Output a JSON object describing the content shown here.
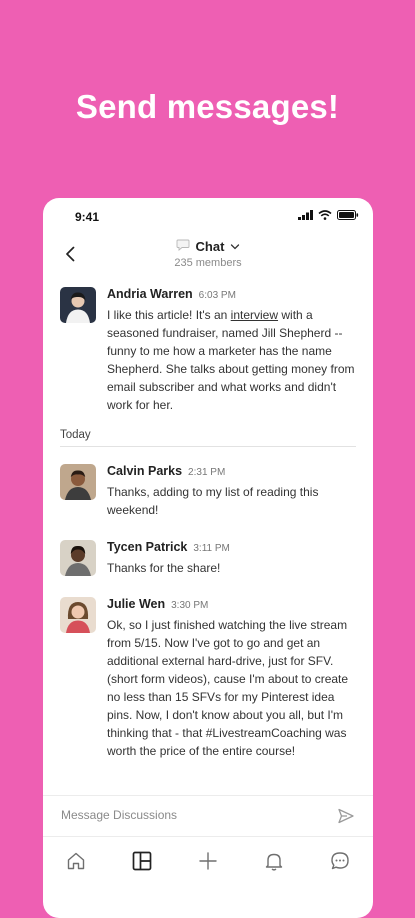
{
  "headline": "Send messages!",
  "status": {
    "time": "9:41"
  },
  "header": {
    "title": "Chat",
    "members": "235 members"
  },
  "messages_top": [
    {
      "name": "Andria Warren",
      "time": "6:03 PM",
      "text_pre": "I like this article! It's an ",
      "link": "interview",
      "text_post": " with a seasoned fundraiser, named Jill Shepherd --funny to me how a marketer has the name Shepherd. She talks about getting money from email subscriber and what works and didn't work for her."
    }
  ],
  "day_label": "Today",
  "messages": [
    {
      "name": "Calvin Parks",
      "time": "2:31 PM",
      "text": "Thanks, adding to my list of reading this weekend!"
    },
    {
      "name": "Tycen Patrick",
      "time": "3:11 PM",
      "text": "Thanks for the share!"
    },
    {
      "name": "Julie Wen",
      "time": "3:30 PM",
      "text": "Ok, so I just finished watching the live stream from 5/15. Now I've got to go and get an additional external hard-drive, just for SFV. (short form videos), cause I'm about to create no less than 15 SFVs for my Pinterest idea pins. Now, I don't know about you all, but I'm thinking that - that #LivestreamCoaching was worth the price of the entire course!"
    }
  ],
  "composer": {
    "placeholder": "Message Discussions"
  },
  "nav": [
    "home-icon",
    "layout-icon",
    "plus-icon",
    "bell-icon",
    "chat-bubble-icon"
  ],
  "colors": {
    "background": "#ee5fb3",
    "card": "#ffffff"
  }
}
